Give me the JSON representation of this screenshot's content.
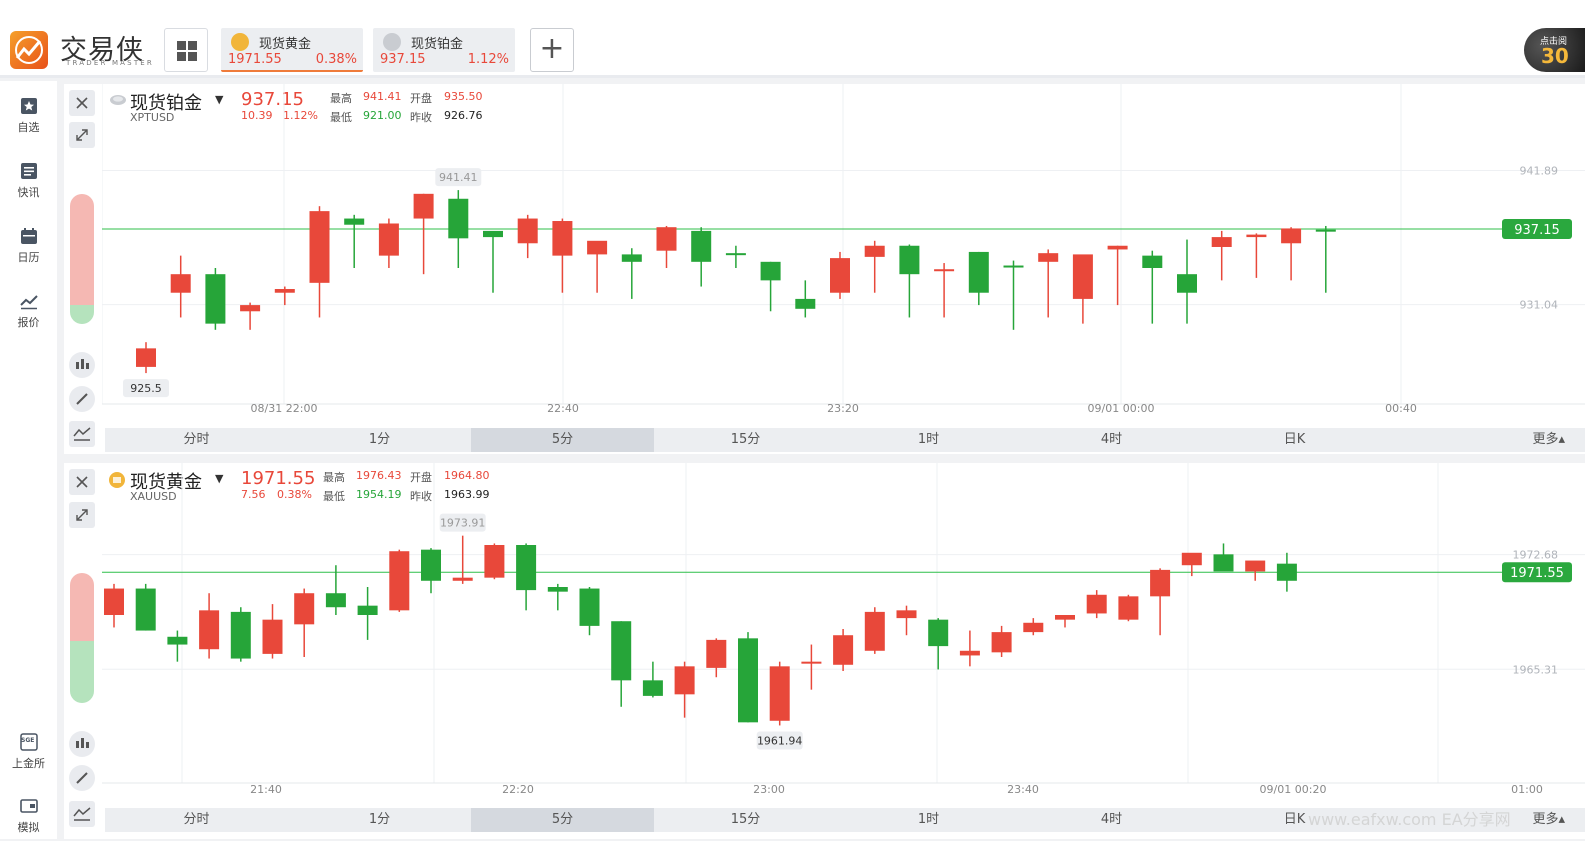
{
  "app": {
    "name": "交易侠",
    "subtitle": "TRADER MASTER"
  },
  "tabs": [
    {
      "name": "现货黄金",
      "price": "1971.55",
      "change_pct": "0.38%",
      "active": true,
      "coin": "gold-coin-icon"
    },
    {
      "name": "现货铂金",
      "price": "937.15",
      "change_pct": "1.12%",
      "active": false,
      "coin": "platinum-coin-icon"
    }
  ],
  "promo": {
    "top": "点击阅",
    "num": "30"
  },
  "sidebar": {
    "items": [
      {
        "label": "自选",
        "icon": "watchlist-icon"
      },
      {
        "label": "快讯",
        "icon": "news-icon"
      },
      {
        "label": "日历",
        "icon": "calendar-icon"
      },
      {
        "label": "报价",
        "icon": "quote-icon"
      },
      {
        "label": "上金所",
        "icon": "sge-icon"
      },
      {
        "label": "模拟",
        "icon": "simulate-icon"
      }
    ],
    "sge_mark": "SGE"
  },
  "timeframes": [
    "分时",
    "1分",
    "5分",
    "15分",
    "1时",
    "4时",
    "日K",
    "更多▴"
  ],
  "panels": [
    {
      "name": "现货铂金",
      "symbol": "XPTUSD",
      "price": "937.15",
      "change": "10.39",
      "change_pct": "1.12%",
      "labels": {
        "high": "最高",
        "low": "最低",
        "open": "开盘",
        "prev_close": "昨收"
      },
      "high": "941.41",
      "low": "921.00",
      "open": "935.50",
      "prev_close": "926.76",
      "active_timeframe": "5分"
    },
    {
      "name": "现货黄金",
      "symbol": "XAUUSD",
      "price": "1971.55",
      "change": "7.56",
      "change_pct": "0.38%",
      "labels": {
        "high": "最高",
        "low": "最低",
        "open": "开盘",
        "prev_close": "昨收"
      },
      "high": "1976.43",
      "low": "1954.19",
      "open": "1964.80",
      "prev_close": "1963.99",
      "active_timeframe": "5分"
    }
  ],
  "chart_data": [
    {
      "type": "candlestick",
      "series_symbol": "XPTUSD",
      "x_ticks": [
        "08/31 22:00",
        "22:40",
        "23:20",
        "09/01 00:00",
        "00:40"
      ],
      "y_ticks": [
        "941.89",
        "931.04"
      ],
      "current_price_label": "937.15",
      "max_marker": "941.41",
      "min_marker": "925.5",
      "ylim": [
        923.0,
        945.0
      ],
      "candles": [
        [
          926.0,
          928.0,
          925.5,
          927.5
        ],
        [
          932.0,
          935.0,
          930.0,
          933.5
        ],
        [
          933.5,
          934.0,
          929.0,
          929.5
        ],
        [
          930.5,
          931.2,
          929.0,
          931.0
        ],
        [
          932.0,
          932.5,
          931.0,
          932.3
        ],
        [
          932.8,
          939.0,
          930.0,
          938.6
        ],
        [
          938.0,
          938.3,
          934.0,
          937.5
        ],
        [
          935.0,
          938.0,
          934.0,
          937.6
        ],
        [
          938.0,
          940.0,
          933.5,
          940.0
        ],
        [
          939.6,
          940.3,
          934.0,
          936.4
        ],
        [
          937.0,
          936.8,
          932.0,
          936.5
        ],
        [
          936.0,
          938.3,
          934.8,
          938.0
        ],
        [
          935.0,
          938.0,
          932.0,
          937.8
        ],
        [
          935.1,
          935.6,
          932.0,
          936.2
        ],
        [
          935.1,
          935.6,
          931.5,
          934.5
        ],
        [
          935.4,
          937.4,
          934.0,
          937.3
        ],
        [
          937.0,
          937.3,
          932.5,
          934.5
        ],
        [
          935.2,
          935.8,
          934.0,
          935.1
        ],
        [
          934.5,
          934.5,
          930.5,
          933.0
        ],
        [
          931.5,
          933.0,
          930.0,
          930.7
        ],
        [
          932.0,
          935.3,
          931.5,
          934.8
        ],
        [
          934.9,
          936.2,
          932.0,
          935.8
        ],
        [
          935.8,
          935.9,
          930.0,
          933.5
        ],
        [
          933.8,
          934.4,
          930.0,
          933.9
        ],
        [
          935.3,
          935.3,
          931.0,
          932.0
        ],
        [
          934.2,
          934.6,
          929.0,
          934.1
        ],
        [
          934.5,
          935.5,
          930.0,
          935.2
        ],
        [
          931.5,
          934.8,
          929.5,
          935.1
        ],
        [
          935.5,
          935.8,
          931.0,
          935.8
        ],
        [
          935.0,
          935.4,
          929.5,
          934.0
        ],
        [
          933.5,
          936.3,
          929.5,
          932.0
        ],
        [
          935.7,
          937.0,
          933.0,
          936.5
        ],
        [
          936.5,
          936.8,
          933.2,
          936.7
        ],
        [
          936.0,
          937.3,
          933.0,
          937.2
        ],
        [
          937.1,
          937.4,
          932.0,
          937.0
        ]
      ]
    },
    {
      "type": "candlestick",
      "series_symbol": "XAUUSD",
      "x_ticks": [
        "21:40",
        "22:20",
        "23:00",
        "23:40",
        "09/01 00:20",
        "01:00"
      ],
      "y_ticks": [
        "1972.68",
        "1965.31"
      ],
      "current_price_label": "1971.55",
      "max_marker": "1973.91",
      "min_marker": "1961.94",
      "ylim": [
        1958.0,
        1976.0
      ],
      "candles": [
        [
          1968.8,
          1970.8,
          1968.0,
          1970.5
        ],
        [
          1970.5,
          1970.8,
          1967.8,
          1967.8
        ],
        [
          1967.4,
          1967.8,
          1965.8,
          1966.9
        ],
        [
          1966.6,
          1970.2,
          1966.0,
          1969.1
        ],
        [
          1969.0,
          1969.3,
          1965.8,
          1966.0
        ],
        [
          1966.3,
          1969.5,
          1966.0,
          1968.5
        ],
        [
          1968.2,
          1970.5,
          1966.1,
          1970.2
        ],
        [
          1970.2,
          1972.0,
          1968.8,
          1969.3
        ],
        [
          1969.4,
          1970.6,
          1967.2,
          1968.8
        ],
        [
          1969.1,
          1973.0,
          1969.0,
          1972.9
        ],
        [
          1973.0,
          1973.1,
          1970.2,
          1971.0
        ],
        [
          1971.0,
          1973.9,
          1970.8,
          1971.2
        ],
        [
          1971.2,
          1973.4,
          1971.1,
          1973.3
        ],
        [
          1973.3,
          1973.4,
          1969.1,
          1970.4
        ],
        [
          1970.6,
          1970.8,
          1969.1,
          1970.3
        ],
        [
          1970.5,
          1970.6,
          1967.5,
          1968.1
        ],
        [
          1968.4,
          1968.4,
          1962.9,
          1964.6
        ],
        [
          1964.6,
          1965.8,
          1963.5,
          1963.6
        ],
        [
          1963.7,
          1965.8,
          1962.2,
          1965.5
        ],
        [
          1965.4,
          1967.3,
          1964.8,
          1967.2
        ],
        [
          1967.3,
          1967.7,
          1961.9,
          1961.9
        ],
        [
          1962.0,
          1965.8,
          1961.7,
          1965.5
        ],
        [
          1965.7,
          1966.9,
          1964.0,
          1965.8
        ],
        [
          1965.6,
          1967.9,
          1965.2,
          1967.5
        ],
        [
          1966.5,
          1969.3,
          1966.3,
          1969.0
        ],
        [
          1968.6,
          1969.4,
          1967.5,
          1969.1
        ],
        [
          1968.5,
          1968.6,
          1965.3,
          1966.8
        ],
        [
          1966.2,
          1967.8,
          1965.5,
          1966.5
        ],
        [
          1966.4,
          1968.1,
          1966.1,
          1967.7
        ],
        [
          1967.7,
          1968.6,
          1967.5,
          1968.3
        ],
        [
          1968.5,
          1968.8,
          1968.0,
          1968.8
        ],
        [
          1968.9,
          1970.4,
          1968.6,
          1970.1
        ],
        [
          1968.5,
          1970.1,
          1968.4,
          1970.0
        ],
        [
          1970.0,
          1971.8,
          1967.5,
          1971.7
        ],
        [
          1972.0,
          1972.6,
          1971.3,
          1972.8
        ],
        [
          1972.7,
          1973.4,
          1971.8,
          1971.6
        ],
        [
          1971.6,
          1972.2,
          1971.0,
          1972.3
        ],
        [
          1972.1,
          1972.8,
          1970.3,
          1971.0
        ]
      ]
    }
  ],
  "colors": {
    "up": "#e8483a",
    "down": "#26a539",
    "priceline": "#2fbf4a",
    "accent": "#ef7b3a"
  },
  "watermark": "www.eafxw.com EA分享网"
}
